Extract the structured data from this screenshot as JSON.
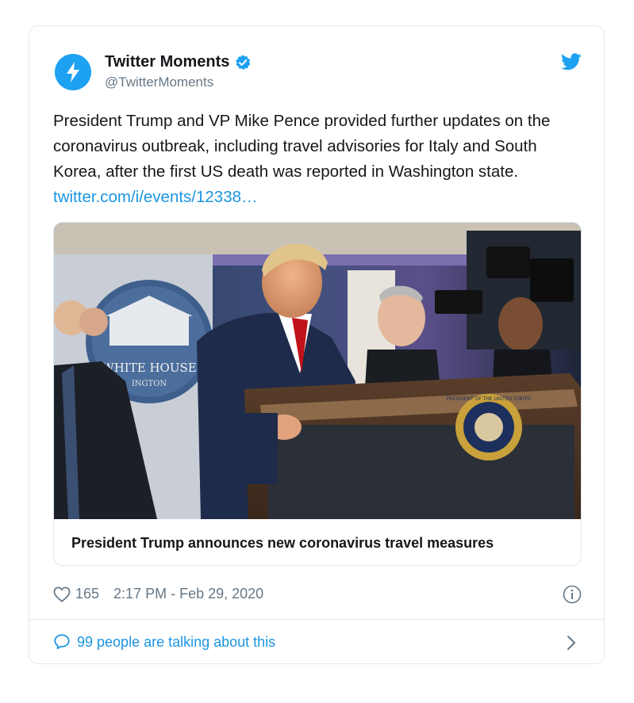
{
  "tweet": {
    "display_name": "Twitter Moments",
    "handle": "@TwitterMoments",
    "text": "President Trump and VP Mike Pence provided further updates on the coronavirus outbreak, including travel advisories for Italy and South Korea, after the first US death was reported in Washington state. ",
    "link": "twitter.com/i/events/12338…",
    "media": {
      "seal_text_top": "PRESIDENT OF THE UNITED STATES",
      "sign_text": "WHITE HOUSE",
      "sign_text_2": "INGTON",
      "caption": "President Trump announces new coronavirus travel measures"
    },
    "likes": "165",
    "timestamp": "2:17 PM - Feb 29, 2020",
    "talking": "99 people are talking about this"
  },
  "icons": {
    "avatar": "lightning-bolt-icon",
    "verified": "verified-badge-icon",
    "brand": "twitter-bird-icon",
    "like": "heart-icon",
    "info": "info-icon",
    "reply": "speech-bubble-icon",
    "more": "chevron-right-icon"
  },
  "colors": {
    "accent": "#1da1f2",
    "link": "#1b95e0",
    "text": "#14171a",
    "muted": "#657786",
    "border": "#e1e8ed"
  }
}
